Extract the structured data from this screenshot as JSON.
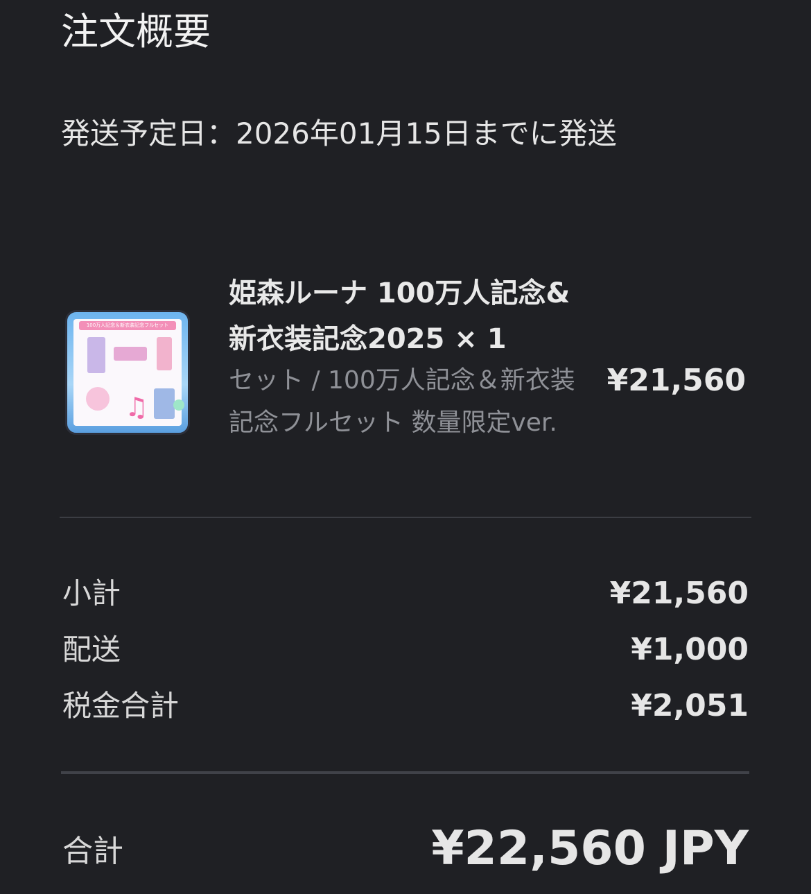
{
  "page": {
    "title": "注文概要",
    "ship_date": "発送予定日：2026年01月15日までに発送"
  },
  "product": {
    "name": "姫森ルーナ 100万人記念&新衣装記念2025 × 1",
    "variant": "セット / 100万人記念＆新衣装記念フルセット 数量限定ver.",
    "price": "¥21,560",
    "thumbnail_banner": "100万人記念＆新衣装記念フルセット"
  },
  "summary": {
    "subtotal_label": "小計",
    "subtotal_value": "¥21,560",
    "shipping_label": "配送",
    "shipping_value": "¥1,000",
    "tax_label": "税金合計",
    "tax_value": "¥2,051"
  },
  "total": {
    "label": "合計",
    "value": "¥22,560 JPY"
  },
  "colors": {
    "background": "#1f2024",
    "text_primary": "#e8e8e8",
    "text_muted": "#8f9197",
    "divider": "#3b3d43"
  }
}
